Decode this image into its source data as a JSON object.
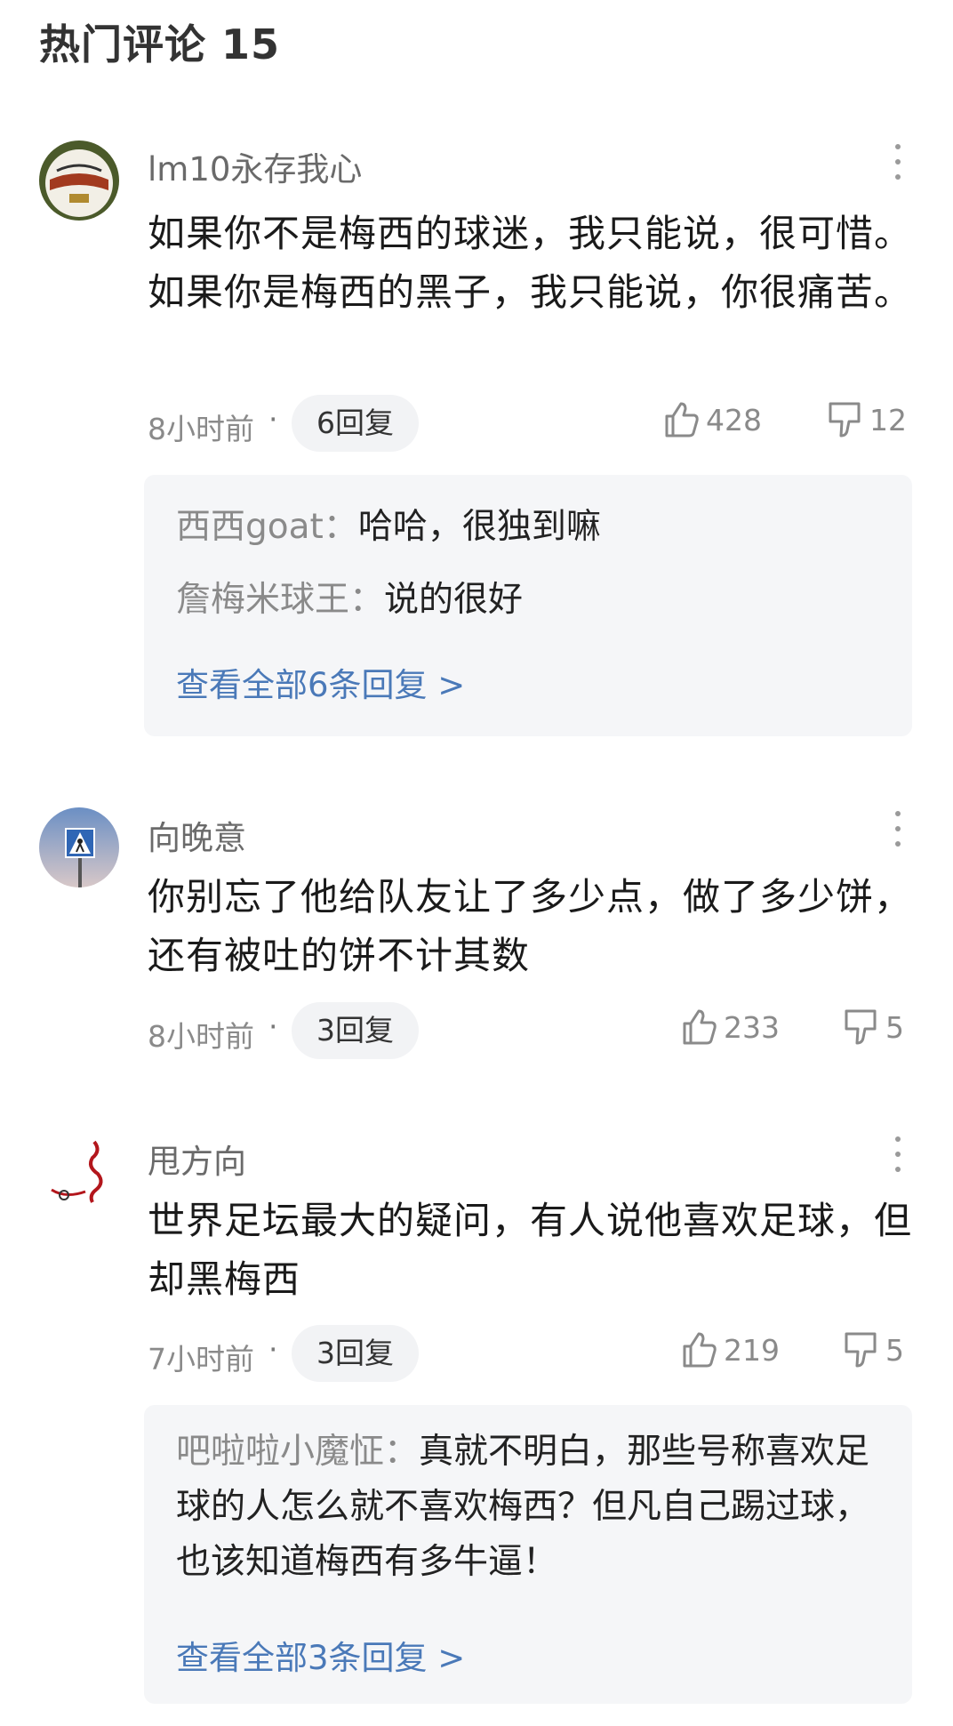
{
  "section": {
    "title": "热门评论 15"
  },
  "comments": [
    {
      "username": "lm10永存我心",
      "content": "如果你不是梅西的球迷，我只能说，很可惜。如果你是梅西的黑子，我只能说，你很痛苦。",
      "time": "8小时前",
      "replies_label": "6回复",
      "likes": "428",
      "dislikes": "12",
      "replies": [
        {
          "author": "西西goat：",
          "text": "哈哈，很独到嘛"
        },
        {
          "author": "詹梅米球王：",
          "text": "说的很好"
        }
      ],
      "view_all": "查看全部6条回复 >"
    },
    {
      "username": "向晚意",
      "content": "你别忘了他给队友让了多少点，做了多少饼，还有被吐的饼不计其数",
      "time": "8小时前",
      "replies_label": "3回复",
      "likes": "233",
      "dislikes": "5"
    },
    {
      "username": "甩方向",
      "content": "世界足坛最大的疑问，有人说他喜欢足球，但却黑梅西",
      "time": "7小时前",
      "replies_label": "3回复",
      "likes": "219",
      "dislikes": "5",
      "replies": [
        {
          "author": "吧啦啦小魔怔：",
          "text": "真就不明白，那些号称喜欢足球的人怎么就不喜欢梅西？但凡自己踢过球，也该知道梅西有多牛逼！"
        }
      ],
      "view_all": "查看全部3条回复 >"
    }
  ],
  "icons": [
    "thumb-up-icon",
    "thumb-down-icon",
    "more-vertical-icon"
  ],
  "colors": {
    "link": "#4a79b8",
    "muted": "#8a8a8a",
    "reply_bg": "#f5f6f8",
    "pill_bg": "#f2f3f5"
  }
}
